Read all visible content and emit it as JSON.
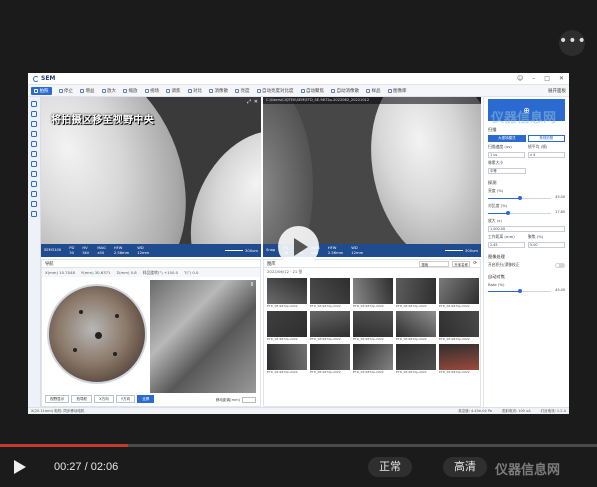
{
  "app": {
    "logo_text": "SEM",
    "toolbar": [
      "拍照",
      "停止",
      "增益",
      "放大",
      "缩放",
      "视场",
      "调焦",
      "对比",
      "消像散",
      "亮度",
      "自动亮度对比度",
      "自动聚焦",
      "自动消像散",
      "样品",
      "图像库"
    ],
    "toolbar_right": "展开面板",
    "overlay_text": "将拍摄区移至视野中央",
    "left_info": [
      {
        "k": "SEM3100",
        "v": ""
      },
      {
        "k": "PD",
        "v": "30"
      },
      {
        "k": "HV",
        "v": "5kV"
      },
      {
        "k": "MAG",
        "v": "x50"
      },
      {
        "k": "HFW",
        "v": "2.56mm"
      },
      {
        "k": "WD",
        "v": "12mm"
      }
    ],
    "left_scale": "300um",
    "right_path": "C:\\Users\\CIQTEK\\SEM\\ETD_SE-9872p-2022062_20221012",
    "right_info": [
      {
        "k": "Snap",
        "v": ""
      },
      {
        "k": "PD",
        "v": "30"
      },
      {
        "k": "HV",
        "v": "5kV"
      },
      {
        "k": "MAG",
        "v": "x50"
      },
      {
        "k": "HFW",
        "v": "2.56mm"
      },
      {
        "k": "WD",
        "v": "12mm"
      }
    ],
    "right_scale": "300um",
    "nav": {
      "title": "导航",
      "row": [
        "X(mm) 10.7048",
        "Y(mm) 30.6371",
        "Z(mm) 0.8",
        "样品旋转(°) +150.0",
        "T(°) 0.0"
      ],
      "buttons": [
        "视野显示",
        "拍导航",
        "X方向",
        "Y方向",
        "全屏"
      ],
      "distance_label": "移动距离(mm)"
    },
    "gallery": {
      "title": "图库",
      "date": "2022/06/12 · 21 张",
      "search_placeholder": "搜索",
      "sort": "升序名称",
      "captions": [
        "ETD_SE-9872p-2022",
        "ETD_SE-9872p-2022",
        "ETD_SE-9872p-2022",
        "ETD_SE-9872p-2022",
        "ETD_SE-9872p-2022",
        "ETD_SE-9872p-2022",
        "ETD_SE-9872p-2022",
        "ETD_SE-9872p-2022",
        "ETD_SE-9872p-2022",
        "ETD_SE-9872p-2022",
        "ETD_SE-9872p-2022",
        "ETD_SE-9872p-2022",
        "ETD_SE-9872p-2022",
        "ETD_SE-9872p-2022",
        "ETD_SE-9872p-2022"
      ]
    },
    "side": {
      "section_scan": "扫描",
      "tab_a": "大视场模式",
      "tab_b": "常规拍照",
      "scan_speed_label": "扫描速度 (us)",
      "frame_label": "帧平均 (帧)",
      "scan_speed": "1 us",
      "frame": "x 4",
      "pixel_label": "像素大小",
      "pixel": "中等",
      "section_det": "探测",
      "brightness_label": "亮度 (%)",
      "brightness": "45.00",
      "contrast_label": "对比度 (%)",
      "contrast": "27.80",
      "mag_label": "放大 (x)",
      "mag": "1,000.00",
      "wd_label": "工作距离 (mm)",
      "focus_label": "聚焦 (%)",
      "wd": "2.45",
      "focus": "5.00",
      "section_img": "图像处理",
      "toggle_label": "开启积分/漂移校正",
      "section_auto": "自动对焦",
      "af_label": "Rate (%)",
      "af": "45.00"
    },
    "status": {
      "left": "X(20.11mm) 电机: 同步移动电机",
      "right1": "真空度: 4.45e-04 Pa",
      "right2": "发射电流: 100 uA",
      "right3": "灯丝电流: 1.2 A"
    }
  },
  "player": {
    "time": "00:27 / 02:06",
    "q1": "正常",
    "q2": "高清",
    "progress": 0.214,
    "watermark_top": "仪器信息网",
    "watermark_bottom": "仪器信息网"
  }
}
